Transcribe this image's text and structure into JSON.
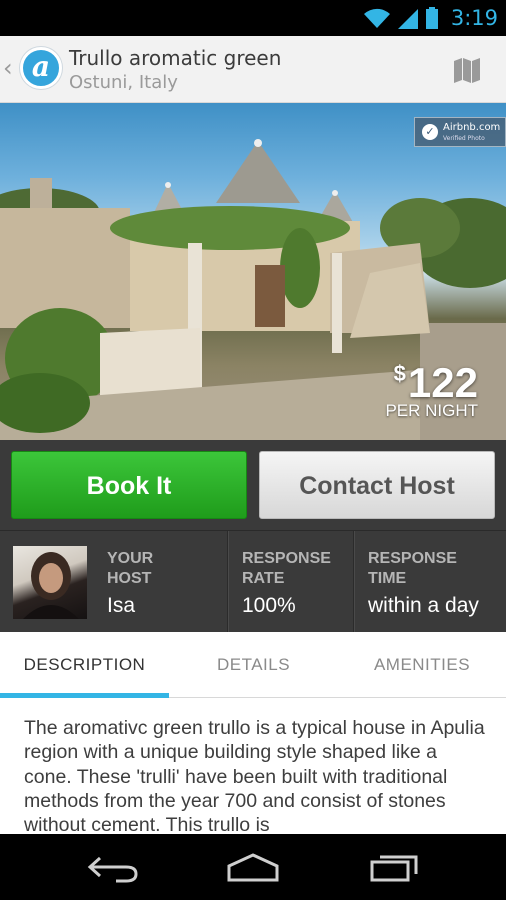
{
  "status_bar": {
    "time": "3:19",
    "icons": [
      "wifi-icon",
      "signal-icon",
      "battery-icon"
    ],
    "accent_color": "#33b5e5"
  },
  "action_bar": {
    "back_icon": "chevron-left-icon",
    "logo_letter": "a",
    "title": "Trullo aromatic green",
    "subtitle": "Ostuni, Italy",
    "map_icon": "map-icon"
  },
  "listing": {
    "badge_line1": "Airbnb.com",
    "badge_line2": "Verified Photo",
    "price_symbol": "$",
    "price": "122",
    "price_period": "PER NIGHT"
  },
  "buttons": {
    "book_label": "Book It",
    "contact_label": "Contact Host",
    "book_color": "#2db12a"
  },
  "host": {
    "your_host_label": "YOUR\nHOST",
    "host_name": "Isa",
    "response_rate_label": "RESPONSE\nRATE",
    "response_rate": "100%",
    "response_time_label": "RESPONSE\nTIME",
    "response_time": "within a day"
  },
  "tabs": [
    {
      "label": "DESCRIPTION",
      "active": true
    },
    {
      "label": "DETAILS",
      "active": false
    },
    {
      "label": "AMENITIES",
      "active": false
    }
  ],
  "description": "The aromativc green trullo is a typical house in Apulia region with a unique building style shaped like a cone. These 'trulli' have been built with traditional methods from the year 700 and consist of stones without cement. This trullo is",
  "nav_bar": {
    "icons": [
      "back-icon",
      "home-icon",
      "recent-apps-icon"
    ]
  }
}
